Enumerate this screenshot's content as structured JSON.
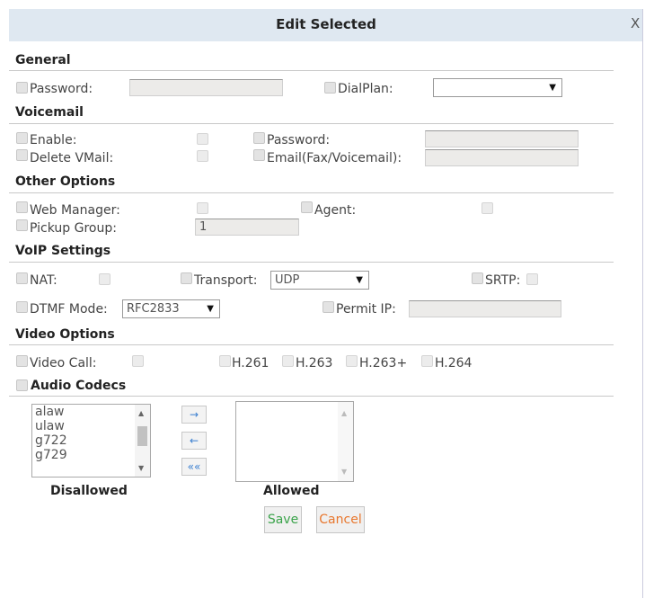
{
  "dialog": {
    "title": "Edit Selected",
    "close_label": "X"
  },
  "general": {
    "heading": "General",
    "password_label": "Password:",
    "password_value": "",
    "dialplan_label": "DialPlan:",
    "dialplan_value": ""
  },
  "voicemail": {
    "heading": "Voicemail",
    "enable_label": "Enable:",
    "password_label": "Password:",
    "password_value": "",
    "delete_label": "Delete VMail:",
    "email_label": "Email(Fax/Voicemail):",
    "email_value": ""
  },
  "other": {
    "heading": "Other Options",
    "web_manager_label": "Web Manager:",
    "agent_label": "Agent:",
    "pickup_label": "Pickup Group:",
    "pickup_value": "1"
  },
  "voip": {
    "heading": "VoIP Settings",
    "nat_label": "NAT:",
    "transport_label": "Transport:",
    "transport_value": "UDP",
    "srtp_label": "SRTP:",
    "dtmf_label": "DTMF Mode:",
    "dtmf_value": "RFC2833",
    "permit_label": "Permit IP:",
    "permit_value": ""
  },
  "video": {
    "heading": "Video Options",
    "video_call_label": "Video Call:",
    "h261": "H.261",
    "h263": "H.263",
    "h263p": "H.263+",
    "h264": "H.264"
  },
  "audio": {
    "heading": "Audio Codecs",
    "disallowed_codecs": [
      "alaw",
      "ulaw",
      "g722",
      "g729"
    ],
    "disallowed_label": "Disallowed",
    "allowed_label": "Allowed",
    "move_right": "→",
    "move_left": "←",
    "move_all_left": "««"
  },
  "actions": {
    "save_label": "Save",
    "cancel_label": "Cancel"
  },
  "colors": {
    "titlebar": "#dfe8f1",
    "save_text": "#3aa34a",
    "cancel_text": "#e8772e",
    "move_arrows": "#3a7fd0"
  }
}
